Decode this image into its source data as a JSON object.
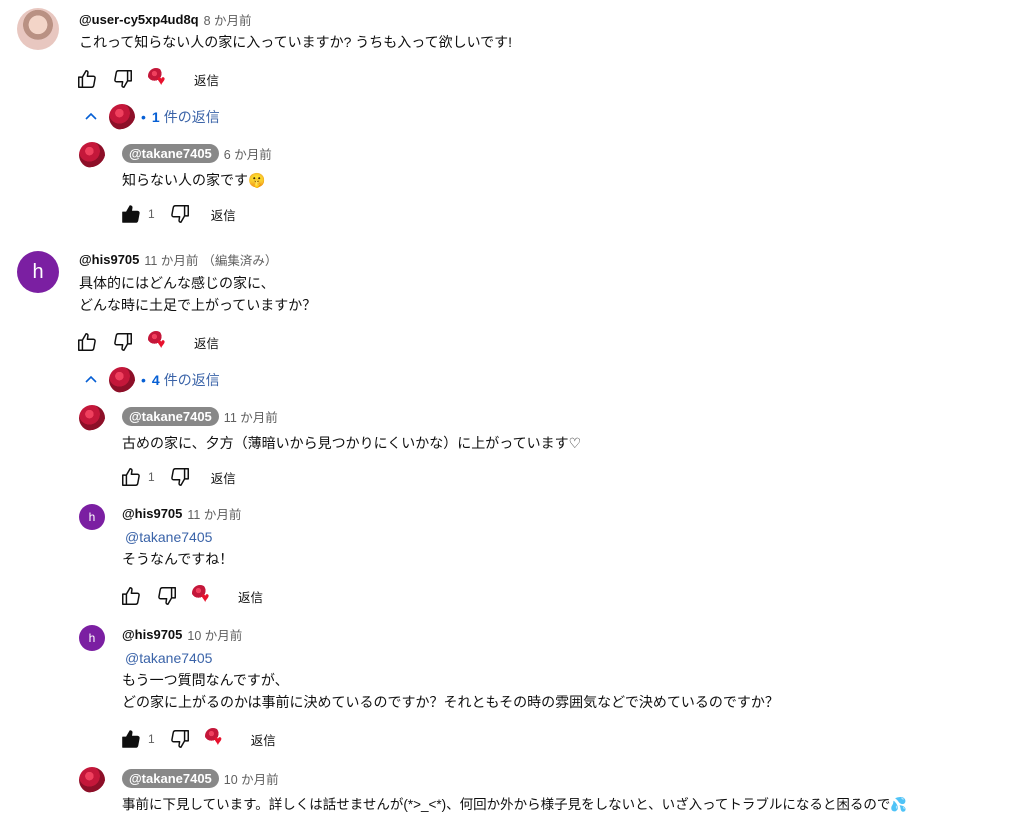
{
  "labels": {
    "reply": "返信"
  },
  "comments": [
    {
      "author": "@user-cy5xp4ud8q",
      "time": "8 か月前",
      "text": [
        "これって知らない人の家に入っていますか? うちも入って欲しいです!"
      ],
      "likes": "",
      "toggle": {
        "count": "1",
        "label": "件の返信"
      }
    },
    {
      "author": "@takane7405",
      "time": "6 か月前",
      "text": [
        "知らない人の家です🤫"
      ],
      "likes": "1"
    },
    {
      "author": "@his9705",
      "avatar_letter": "h",
      "time": "11 か月前",
      "edited": "（編集済み）",
      "text": [
        "具体的にはどんな感じの家に、",
        "どんな時に土足で上がっていますか？"
      ],
      "likes": "",
      "toggle": {
        "count": "4",
        "label": "件の返信"
      }
    },
    {
      "author": "@takane7405",
      "time": "11 か月前",
      "text": [
        "古めの家に、夕方（薄暗いから見つかりにくいかな）に上がっています♡"
      ],
      "likes": "1"
    },
    {
      "author": "@his9705",
      "avatar_letter": "h",
      "time": "11 か月前",
      "mention": "@takane7405",
      "text": [
        "そうなんですね！"
      ],
      "likes": ""
    },
    {
      "author": "@his9705",
      "avatar_letter": "h",
      "time": "10 か月前",
      "mention": "@takane7405",
      "text": [
        "もう一つ質問なんですが、",
        "どの家に上がるのかは事前に決めているのですか？それともその時の雰囲気などで決めているのですか？"
      ],
      "likes": "1"
    },
    {
      "author": "@takane7405",
      "time": "10 か月前",
      "text": [
        "事前に下見しています。詳しくは話せませんが(*>_<*)、何回か外から様子見をしないと、いざ入ってトラブルになると困るので💦"
      ],
      "likes": ""
    }
  ],
  "colors": {
    "link": "#065fd4",
    "chip": "#888888",
    "avatar_purple": "#7b1fa2"
  }
}
